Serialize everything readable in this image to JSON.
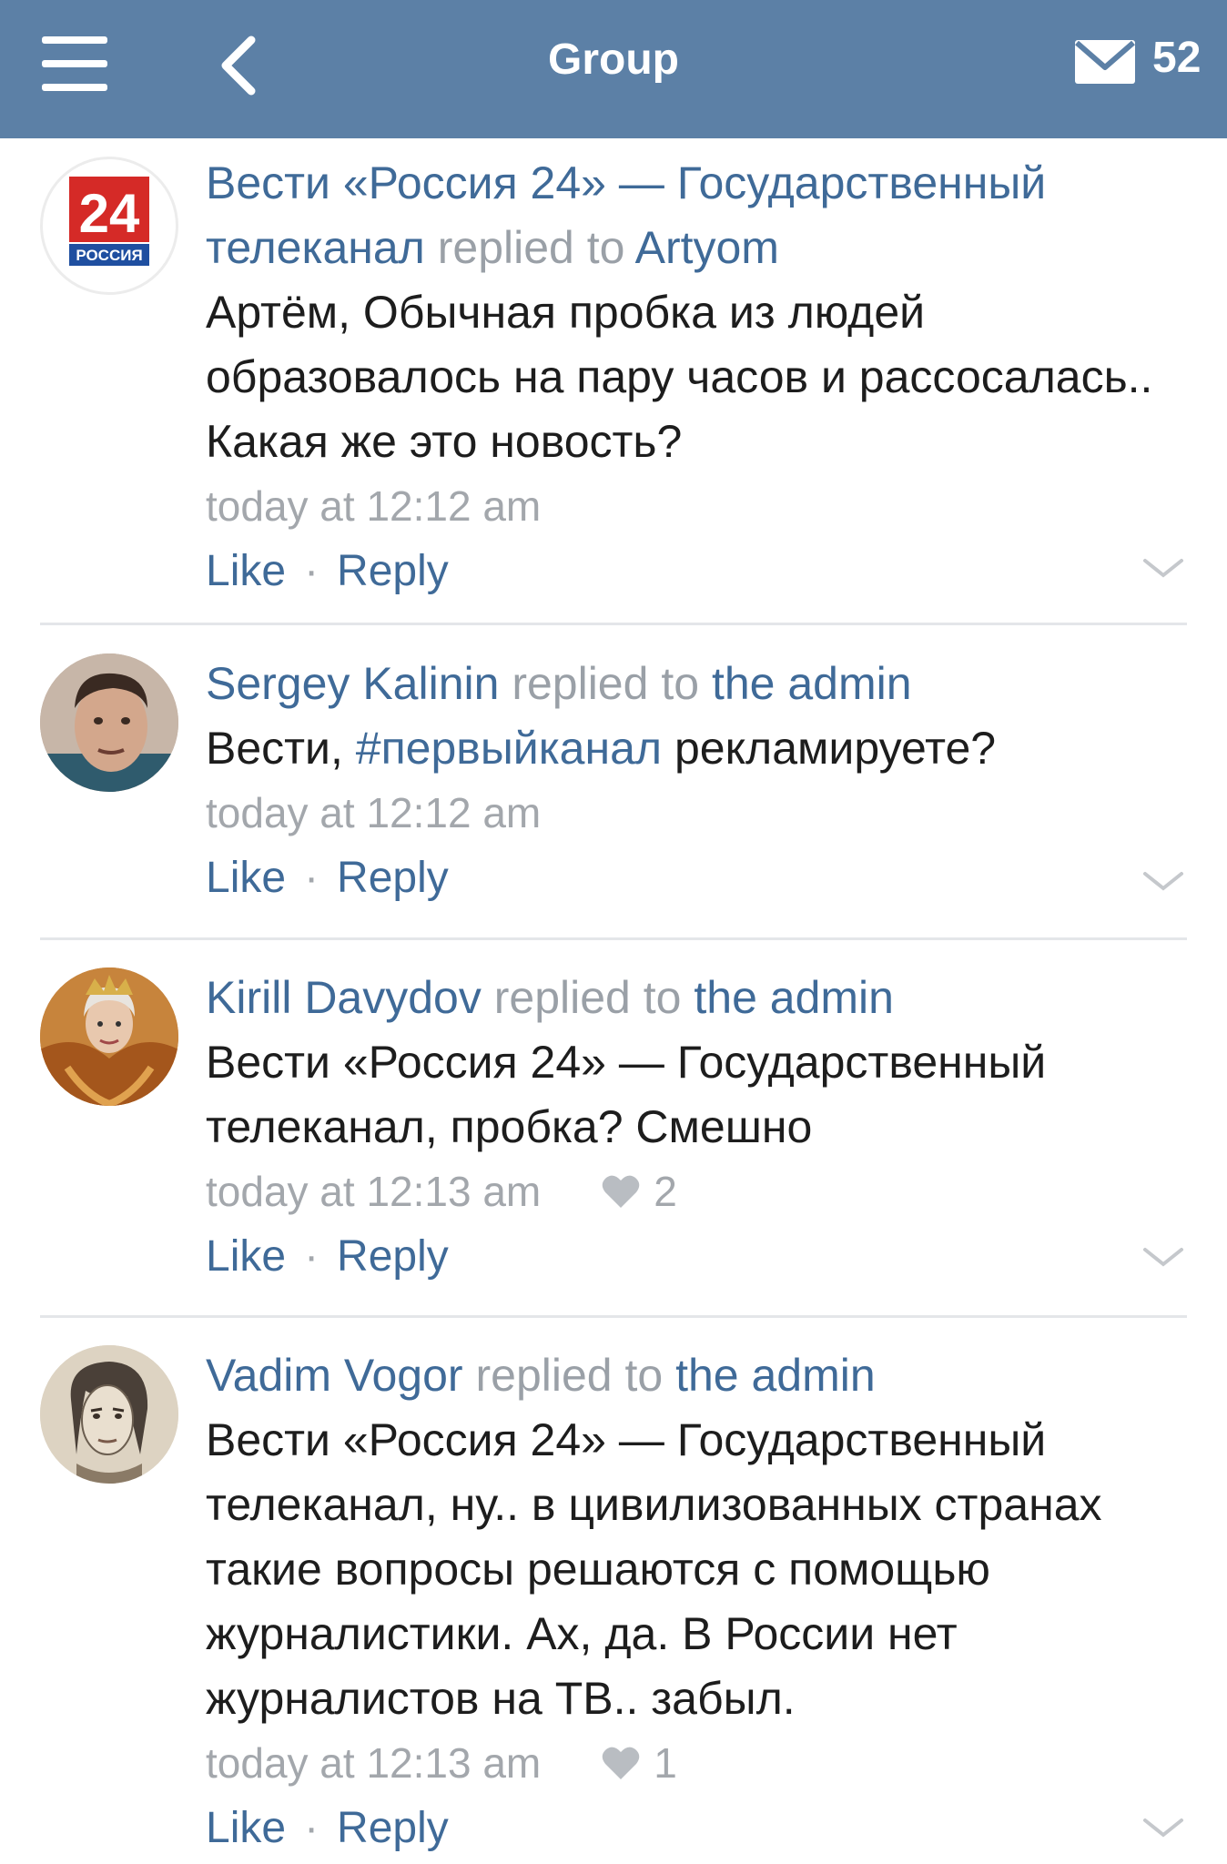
{
  "header": {
    "title": "Group",
    "mail_count": "52"
  },
  "comments": [
    {
      "author": "Вести «Россия 24» — Государственный",
      "author_cont": "телеканал",
      "replied": "replied to",
      "target": "Artyom",
      "lines": [
        "Артём, Обычная пробка из людей",
        "образовалось на пару часов и рассосалась..",
        "Какая же это новость?"
      ],
      "time": "today at 12:12 am",
      "like": "Like",
      "reply": "Reply",
      "avatar_logo": {
        "number": "24",
        "caption": "РОССИЯ"
      }
    },
    {
      "author": "Sergey Kalinin",
      "replied": "replied to",
      "target": "the admin",
      "text_prefix": "Вести, ",
      "hashtag": "#первыйканал",
      "text_suffix": " рекламируете?",
      "time": "today at 12:12 am",
      "like": "Like",
      "reply": "Reply"
    },
    {
      "author": "Kirill Davydov",
      "replied": "replied to",
      "target": "the admin",
      "lines": [
        "Вести «Россия 24» — Государственный",
        "телеканал, пробка? Смешно"
      ],
      "time": "today at 12:13 am",
      "likes_count": "2",
      "like": "Like",
      "reply": "Reply"
    },
    {
      "author": "Vadim Vogor",
      "replied": "replied to",
      "target": "the admin",
      "lines": [
        "Вести «Россия 24» — Государственный",
        "телеканал, ну.. в цивилизованных странах",
        "такие вопросы решаются с помощью",
        "журналистики. Ах, да. В России нет",
        "журналистов на ТВ.. забыл."
      ],
      "time": "today at 12:13 am",
      "likes_count": "1",
      "like": "Like",
      "reply": "Reply"
    }
  ],
  "colors": {
    "header_bg": "#5c80a6",
    "link": "#3f6a98",
    "muted": "#a3a7ac",
    "text": "#1d1d1d"
  }
}
